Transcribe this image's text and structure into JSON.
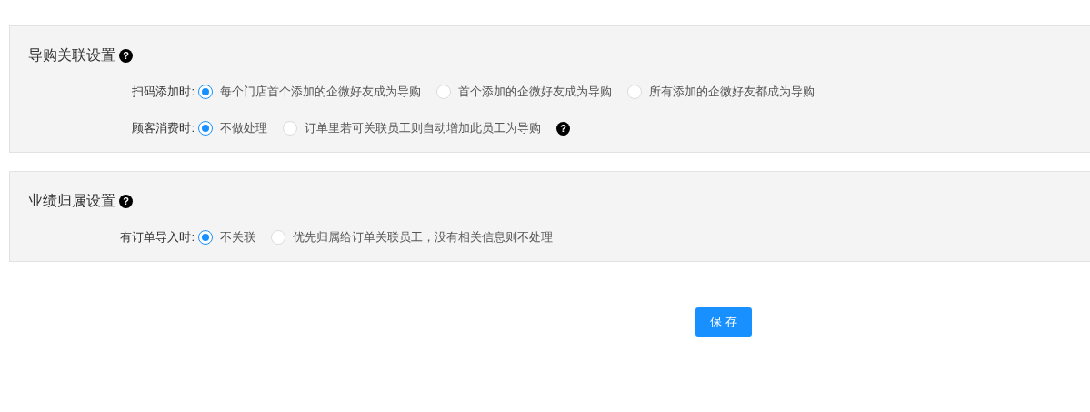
{
  "sections": [
    {
      "title": "导购关联设置",
      "help": "?",
      "rows": [
        {
          "label": "扫码添加时:",
          "options": [
            {
              "label": "每个门店首个添加的企微好友成为导购",
              "selected": true
            },
            {
              "label": "首个添加的企微好友成为导购",
              "selected": false
            },
            {
              "label": "所有添加的企微好友都成为导购",
              "selected": false
            }
          ]
        },
        {
          "label": "顾客消费时:",
          "options": [
            {
              "label": "不做处理",
              "selected": true
            },
            {
              "label": "订单里若可关联员工则自动增加此员工为导购",
              "selected": false
            }
          ],
          "help": "?"
        }
      ]
    },
    {
      "title": "业绩归属设置",
      "help": "?",
      "rows": [
        {
          "label": "有订单导入时:",
          "options": [
            {
              "label": "不关联",
              "selected": true
            },
            {
              "label": "优先归属给订单关联员工，没有相关信息则不处理",
              "selected": false
            }
          ]
        }
      ]
    }
  ],
  "save_button": "保 存"
}
